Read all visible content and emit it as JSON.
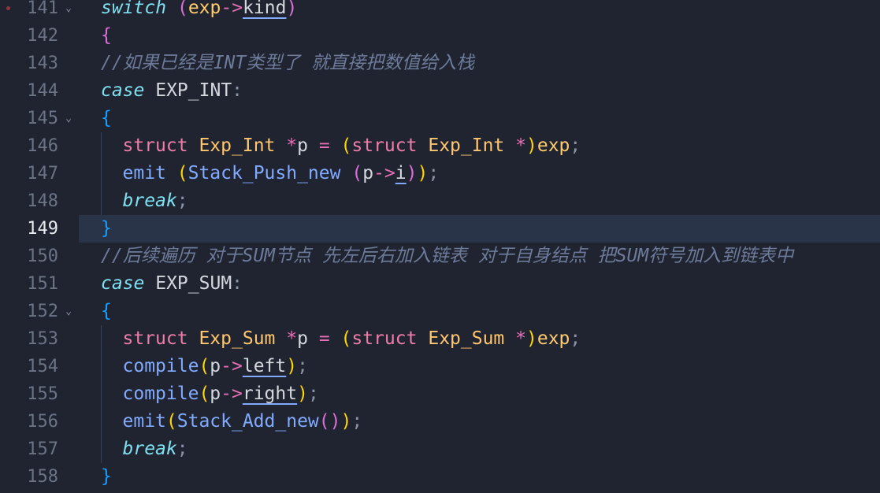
{
  "editor": {
    "current_line": "149",
    "lines": [
      {
        "num": "141",
        "fold": true,
        "breakpoint": true,
        "indent": 0,
        "tokens": [
          {
            "t": "switch",
            "c": "kw-ital"
          },
          {
            "t": " ",
            "c": "plain"
          },
          {
            "t": "(",
            "c": "b2"
          },
          {
            "t": "exp",
            "c": "var"
          },
          {
            "t": "->",
            "c": "op"
          },
          {
            "t": "kind",
            "c": "field"
          },
          {
            "t": ")",
            "c": "b2"
          }
        ]
      },
      {
        "num": "142",
        "fold": false,
        "indent": 0,
        "tokens": [
          {
            "t": "{",
            "c": "b2"
          }
        ]
      },
      {
        "num": "143",
        "fold": false,
        "indent": 0,
        "tokens": [
          {
            "t": "//如果已经是INT类型了 就直接把数值给入栈",
            "c": "comment"
          }
        ]
      },
      {
        "num": "144",
        "fold": false,
        "indent": 0,
        "tokens": [
          {
            "t": "case",
            "c": "kw-ital"
          },
          {
            "t": " EXP_INT",
            "c": "plain"
          },
          {
            "t": ":",
            "c": "punct"
          }
        ]
      },
      {
        "num": "145",
        "fold": true,
        "indent": 0,
        "tokens": [
          {
            "t": "{",
            "c": "b3"
          }
        ]
      },
      {
        "num": "146",
        "fold": false,
        "indent": 1,
        "tokens": [
          {
            "t": "struct",
            "c": "type"
          },
          {
            "t": " ",
            "c": "plain"
          },
          {
            "t": "Exp_Int",
            "c": "struct-name"
          },
          {
            "t": " ",
            "c": "plain"
          },
          {
            "t": "*",
            "c": "op"
          },
          {
            "t": "p ",
            "c": "plain"
          },
          {
            "t": "=",
            "c": "op"
          },
          {
            "t": " ",
            "c": "plain"
          },
          {
            "t": "(",
            "c": "b1"
          },
          {
            "t": "struct",
            "c": "type"
          },
          {
            "t": " ",
            "c": "plain"
          },
          {
            "t": "Exp_Int",
            "c": "struct-name"
          },
          {
            "t": " ",
            "c": "plain"
          },
          {
            "t": "*",
            "c": "op"
          },
          {
            "t": ")",
            "c": "b1"
          },
          {
            "t": "exp",
            "c": "var"
          },
          {
            "t": ";",
            "c": "punct"
          }
        ]
      },
      {
        "num": "147",
        "fold": false,
        "indent": 1,
        "tokens": [
          {
            "t": "emit",
            "c": "fn"
          },
          {
            "t": " ",
            "c": "plain"
          },
          {
            "t": "(",
            "c": "b1"
          },
          {
            "t": "Stack_Push_new",
            "c": "fn"
          },
          {
            "t": " ",
            "c": "plain"
          },
          {
            "t": "(",
            "c": "b2"
          },
          {
            "t": "p",
            "c": "plain"
          },
          {
            "t": "->",
            "c": "op"
          },
          {
            "t": "i",
            "c": "field"
          },
          {
            "t": ")",
            "c": "b2"
          },
          {
            "t": ")",
            "c": "b1"
          },
          {
            "t": ";",
            "c": "punct"
          }
        ]
      },
      {
        "num": "148",
        "fold": false,
        "indent": 1,
        "tokens": [
          {
            "t": "break",
            "c": "kw-ital"
          },
          {
            "t": ";",
            "c": "punct"
          }
        ]
      },
      {
        "num": "149",
        "fold": false,
        "indent": 0,
        "current": true,
        "tokens": [
          {
            "t": "}",
            "c": "b3"
          }
        ]
      },
      {
        "num": "150",
        "fold": false,
        "indent": 0,
        "tokens": [
          {
            "t": "//后续遍历 对于SUM节点 先左后右加入链表 对于自身结点 把SUM符号加入到链表中",
            "c": "comment"
          }
        ]
      },
      {
        "num": "151",
        "fold": false,
        "indent": 0,
        "tokens": [
          {
            "t": "case",
            "c": "kw-ital"
          },
          {
            "t": " EXP_SUM",
            "c": "plain"
          },
          {
            "t": ":",
            "c": "punct"
          }
        ]
      },
      {
        "num": "152",
        "fold": true,
        "indent": 0,
        "tokens": [
          {
            "t": "{",
            "c": "b3"
          }
        ]
      },
      {
        "num": "153",
        "fold": false,
        "indent": 1,
        "tokens": [
          {
            "t": "struct",
            "c": "type"
          },
          {
            "t": " ",
            "c": "plain"
          },
          {
            "t": "Exp_Sum",
            "c": "struct-name"
          },
          {
            "t": " ",
            "c": "plain"
          },
          {
            "t": "*",
            "c": "op"
          },
          {
            "t": "p ",
            "c": "plain"
          },
          {
            "t": "=",
            "c": "op"
          },
          {
            "t": " ",
            "c": "plain"
          },
          {
            "t": "(",
            "c": "b1"
          },
          {
            "t": "struct",
            "c": "type"
          },
          {
            "t": " ",
            "c": "plain"
          },
          {
            "t": "Exp_Sum",
            "c": "struct-name"
          },
          {
            "t": " ",
            "c": "plain"
          },
          {
            "t": "*",
            "c": "op"
          },
          {
            "t": ")",
            "c": "b1"
          },
          {
            "t": "exp",
            "c": "var"
          },
          {
            "t": ";",
            "c": "punct"
          }
        ]
      },
      {
        "num": "154",
        "fold": false,
        "indent": 1,
        "tokens": [
          {
            "t": "compile",
            "c": "fn"
          },
          {
            "t": "(",
            "c": "b1"
          },
          {
            "t": "p",
            "c": "plain"
          },
          {
            "t": "->",
            "c": "op"
          },
          {
            "t": "left",
            "c": "field"
          },
          {
            "t": ")",
            "c": "b1"
          },
          {
            "t": ";",
            "c": "punct"
          }
        ]
      },
      {
        "num": "155",
        "fold": false,
        "indent": 1,
        "tokens": [
          {
            "t": "compile",
            "c": "fn"
          },
          {
            "t": "(",
            "c": "b1"
          },
          {
            "t": "p",
            "c": "plain"
          },
          {
            "t": "->",
            "c": "op"
          },
          {
            "t": "right",
            "c": "field"
          },
          {
            "t": ")",
            "c": "b1"
          },
          {
            "t": ";",
            "c": "punct"
          }
        ]
      },
      {
        "num": "156",
        "fold": false,
        "indent": 1,
        "tokens": [
          {
            "t": "emit",
            "c": "fn"
          },
          {
            "t": "(",
            "c": "b1"
          },
          {
            "t": "Stack_Add_new",
            "c": "fn"
          },
          {
            "t": "(",
            "c": "b2"
          },
          {
            "t": ")",
            "c": "b2"
          },
          {
            "t": ")",
            "c": "b1"
          },
          {
            "t": ";",
            "c": "punct"
          }
        ]
      },
      {
        "num": "157",
        "fold": false,
        "indent": 1,
        "tokens": [
          {
            "t": "break",
            "c": "kw-ital"
          },
          {
            "t": ";",
            "c": "punct"
          }
        ]
      },
      {
        "num": "158",
        "fold": false,
        "indent": 0,
        "tokens": [
          {
            "t": "}",
            "c": "b3"
          }
        ]
      }
    ]
  }
}
